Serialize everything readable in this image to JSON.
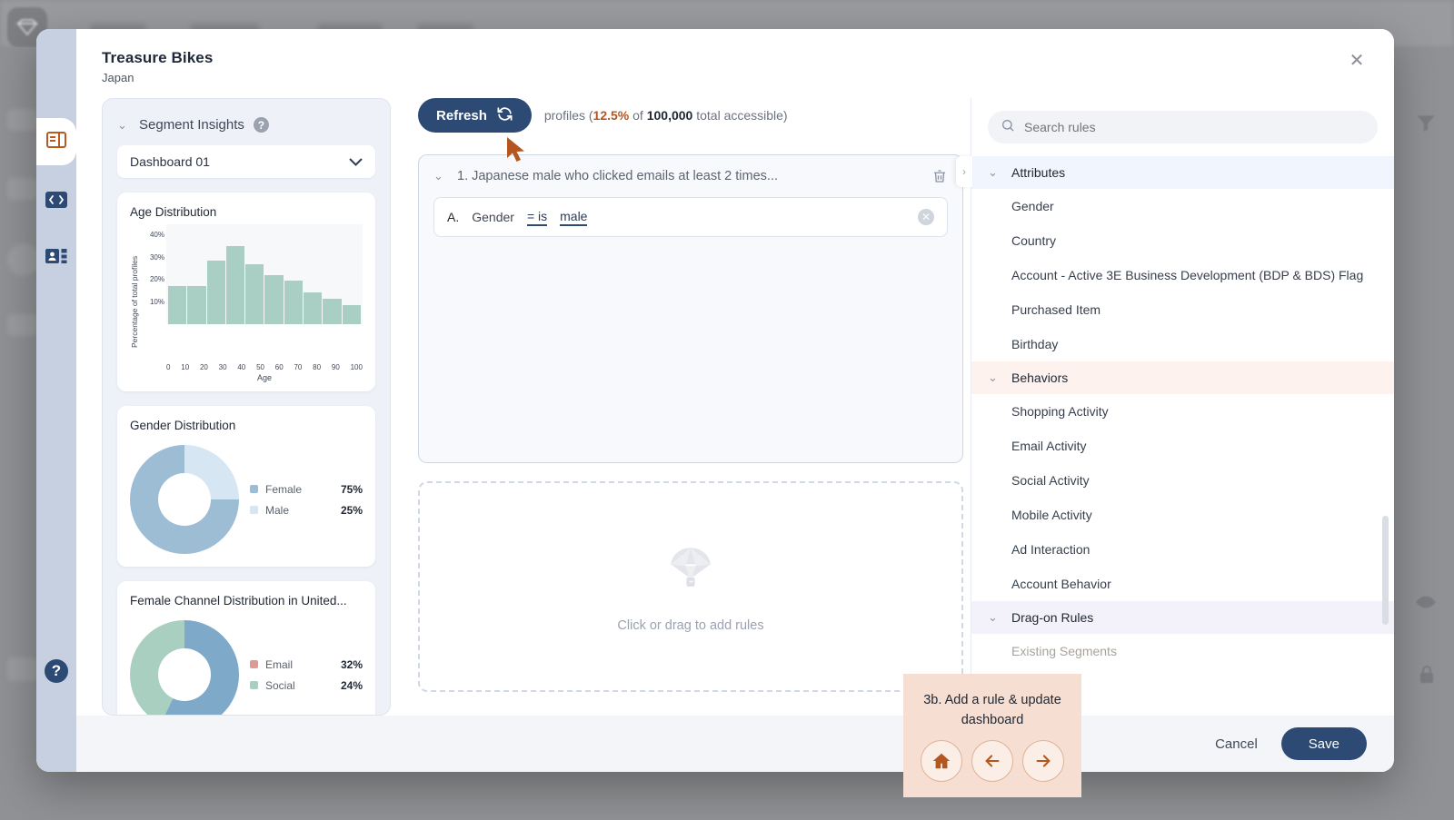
{
  "backdrop": {
    "logo_icon": "diamond-logo-icon",
    "side_icons": [
      "filter-icon",
      "eye-icon",
      "lock-icon"
    ]
  },
  "modal": {
    "title": "Treasure Bikes",
    "subtitle": "Japan",
    "close_icon": "close-icon"
  },
  "rail": {
    "items": [
      {
        "name": "panel-layout-icon",
        "active": true
      },
      {
        "name": "code-icon",
        "active": false
      },
      {
        "name": "contact-card-icon",
        "active": false
      }
    ],
    "help_label": "?"
  },
  "insights": {
    "title": "Segment Insights",
    "help_icon": "question-mark-icon",
    "collapse_icon": "chevron-down-icon",
    "dashboard_select": {
      "value": "Dashboard 01",
      "caret_icon": "chevron-down-icon"
    },
    "cards": [
      {
        "title": "Age Distribution"
      },
      {
        "title": "Gender Distribution"
      },
      {
        "title": "Female Channel Distribution in United..."
      }
    ]
  },
  "chart_data": [
    {
      "type": "bar",
      "title": "Age Distribution",
      "xlabel": "Age",
      "ylabel": "Percentage of total profiles",
      "categories": [
        "0",
        "10",
        "20",
        "30",
        "40",
        "50",
        "60",
        "70",
        "80",
        "90"
      ],
      "tick_labels": [
        "0",
        "10",
        "20",
        "30",
        "40",
        "50",
        "60",
        "70",
        "80",
        "90",
        "100"
      ],
      "values": [
        17,
        17,
        28.5,
        35,
        27,
        22,
        19.5,
        14.5,
        11.5,
        8.5
      ],
      "ytick_labels": [
        "40%",
        "30%",
        "20%",
        "10%"
      ],
      "ylim": [
        0,
        45
      ],
      "color": "#a9cec4",
      "grid": false,
      "legend": "none"
    },
    {
      "type": "pie",
      "title": "Gender Distribution",
      "labels": [
        "Female",
        "Male"
      ],
      "values": [
        75,
        25
      ],
      "value_labels": [
        "75%",
        "25%"
      ],
      "colors": [
        "#9cbdd4",
        "#d6e6f2"
      ],
      "legend": "right"
    },
    {
      "type": "pie",
      "title": "Female Channel Distribution in United...",
      "labels": [
        "Email",
        "Social"
      ],
      "values": [
        32,
        24
      ],
      "value_labels": [
        "32%",
        "24%"
      ],
      "colors": [
        "#e09a95",
        "#a9cec4"
      ],
      "slice_colors": [
        "#7fa9c9",
        "#a9cfc0"
      ],
      "legend": "right"
    }
  ],
  "builder": {
    "refresh_label": "Refresh",
    "refresh_icon": "refresh-icon",
    "profile_prefix": "profiles (",
    "profile_pct": "12.5%",
    "profile_mid": " of ",
    "profile_total": "100,000",
    "profile_suffix": " total accessible)",
    "cursor_icon": "cursor-arrow-icon",
    "rule_group": {
      "collapse_icon": "chevron-down-icon",
      "label": "1. Japanese male who clicked emails at least 2 times...",
      "delete_icon": "trash-icon"
    },
    "condition": {
      "letter": "A.",
      "field": "Gender",
      "operator": "= is",
      "value": "male",
      "remove_icon": "close-circle-icon"
    },
    "dropzone": {
      "icon": "parachute-icon",
      "text": "Click or drag to add rules"
    }
  },
  "rules_panel": {
    "collapse_icon": "chevron-right-icon",
    "search": {
      "placeholder": "Search rules",
      "icon": "search-icon",
      "value": ""
    },
    "groups": [
      {
        "label": "Attributes",
        "style": "attributes",
        "collapse_icon": "chevron-down-icon",
        "items": [
          {
            "label": "Gender",
            "muted": false
          },
          {
            "label": "Country",
            "muted": false
          },
          {
            "label": "Account - Active 3E Business Development (BDP & BDS) Flag",
            "muted": false
          },
          {
            "label": "Purchased Item",
            "muted": false
          },
          {
            "label": "Birthday",
            "muted": false
          }
        ]
      },
      {
        "label": "Behaviors",
        "style": "behaviors",
        "collapse_icon": "chevron-down-icon",
        "items": [
          {
            "label": "Shopping Activity",
            "muted": false
          },
          {
            "label": "Email Activity",
            "muted": false
          },
          {
            "label": "Social Activity",
            "muted": false
          },
          {
            "label": "Mobile Activity",
            "muted": false
          },
          {
            "label": "Ad Interaction",
            "muted": false
          },
          {
            "label": "Account Behavior",
            "muted": false
          }
        ]
      },
      {
        "label": "Drag-on Rules",
        "style": "dragon",
        "collapse_icon": "chevron-down-icon",
        "items": [
          {
            "label": "Existing Segments",
            "muted": true
          }
        ]
      }
    ]
  },
  "footer": {
    "cancel_label": "Cancel",
    "save_label": "Save"
  },
  "coach": {
    "text": "3b. Add a rule & update dashboard",
    "buttons": [
      {
        "name": "home-icon"
      },
      {
        "name": "arrow-left-icon"
      },
      {
        "name": "arrow-right-icon"
      }
    ]
  },
  "colors": {
    "primary": "#2c4a74",
    "accent_orange": "#b4561f",
    "rail_bg": "#c6d0e0",
    "teal": "#a9cec4"
  }
}
